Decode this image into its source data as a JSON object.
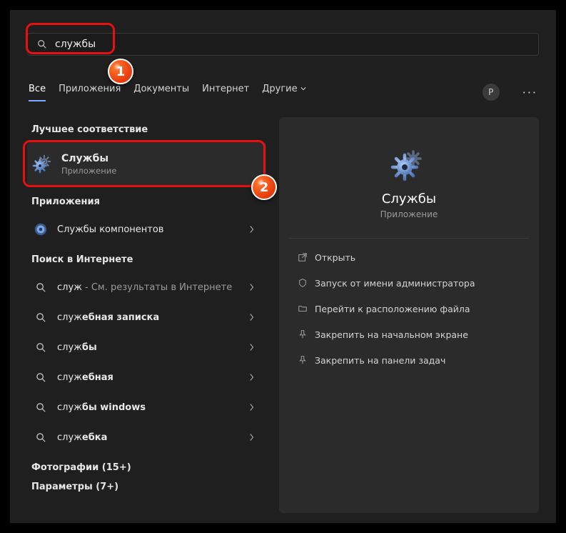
{
  "search": {
    "value": "службы"
  },
  "tabs": {
    "all": "Все",
    "apps": "Приложения",
    "docs": "Документы",
    "web": "Интернет",
    "other": "Другие"
  },
  "avatar_letter": "P",
  "left": {
    "best_match_label": "Лучшее соответствие",
    "hero": {
      "title": "Службы",
      "subtitle": "Приложение"
    },
    "apps_label": "Приложения",
    "apps": {
      "item1": "Службы компонентов"
    },
    "web_label": "Поиск в Интернете",
    "web": {
      "item1_prefix": "служ",
      "item1_suffix": " - См. результаты в Интернете",
      "item2_prefix": "служ",
      "item2_suffix": "ебная записка",
      "item3_prefix": "служ",
      "item3_suffix": "бы",
      "item4_prefix": "служ",
      "item4_suffix": "ебная",
      "item5_prefix": "служ",
      "item5_suffix": "бы windows",
      "item6_prefix": "служ",
      "item6_suffix": "ебка"
    },
    "photos_label": "Фотографии (15+)",
    "params_label": "Параметры (7+)"
  },
  "right": {
    "title": "Службы",
    "subtitle": "Приложение",
    "actions": {
      "open": "Открыть",
      "runas": "Запуск от имени администратора",
      "location": "Перейти к расположению файла",
      "pin_start": "Закрепить на начальном экране",
      "pin_taskbar": "Закрепить на панели задач"
    }
  },
  "annotations": {
    "badge1": "1",
    "badge2": "2"
  }
}
